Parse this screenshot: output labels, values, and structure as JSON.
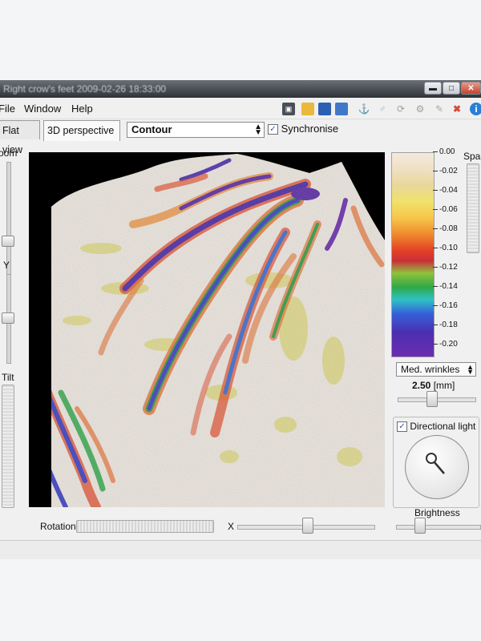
{
  "window": {
    "title": "Right crow's feet 2009-02-26 18:33:00"
  },
  "menu": [
    "File",
    "Window",
    "Help"
  ],
  "toolbar": {
    "icons": [
      "clapper-icon",
      "open-folder-icon",
      "save-icon",
      "save-all-icon",
      "anchor-icon",
      "pin-icon",
      "rotate-icon",
      "gear-icon",
      "pencil-icon",
      "delete-x-icon",
      "info-icon"
    ]
  },
  "tabs": {
    "flat": "Flat view",
    "perspective": "3D perspective",
    "mode": "Contour",
    "sync": "Synchronise"
  },
  "left": {
    "zoom": "oom",
    "y": "Y",
    "tilt": "Tilt"
  },
  "legend": {
    "ticks": [
      "0.00",
      "-0.02",
      "-0.04",
      "-0.06",
      "-0.08",
      "-0.10",
      "-0.12",
      "-0.14",
      "-0.16",
      "-0.18",
      "-0.20"
    ]
  },
  "right": {
    "spacing": "Spac",
    "filter": "Med. wrinkles",
    "filter_value": "2.50",
    "filter_unit": "[mm]",
    "directional_light": "Directional light",
    "brightness": "Brightness"
  },
  "bottom": {
    "rotation": "Rotation",
    "x": "X"
  }
}
